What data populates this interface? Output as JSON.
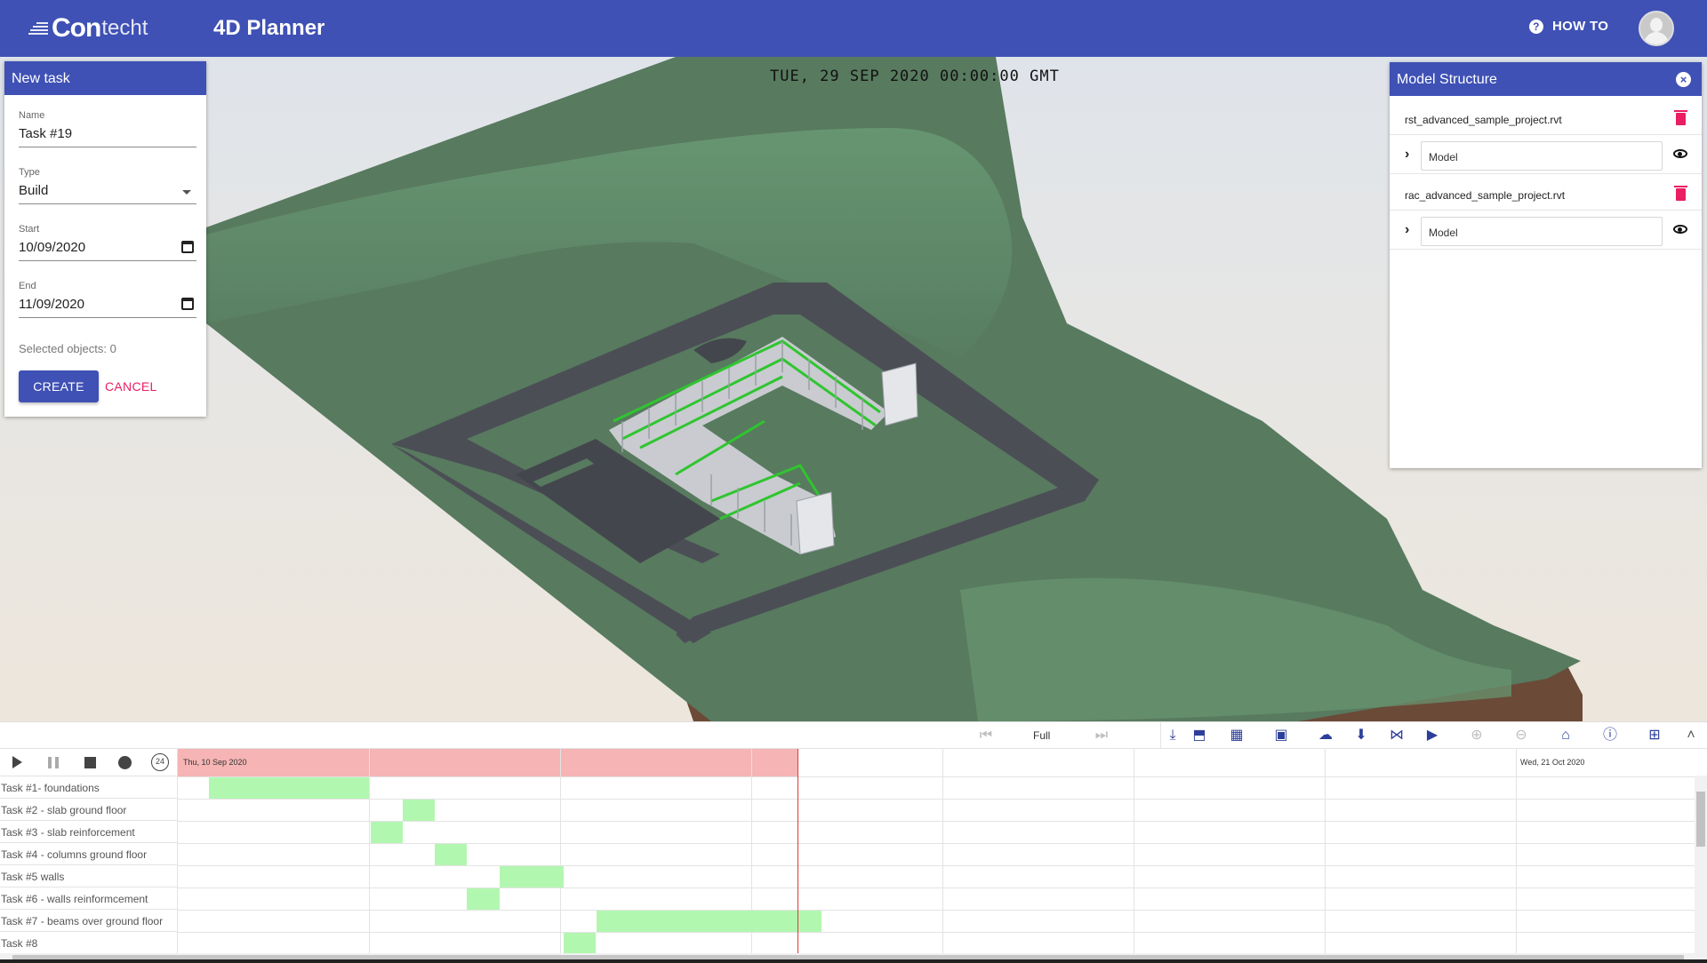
{
  "header": {
    "logo_c": "Con",
    "logo_t": "techt",
    "title": "4D Planner",
    "howto_label": "HOW TO",
    "colors": {
      "primary": "#3f51b5"
    }
  },
  "viewport": {
    "timestamp": "TUE, 29 SEP 2020 00:00:00 GMT"
  },
  "new_task": {
    "title": "New task",
    "name_label": "Name",
    "name_value": "Task #19",
    "type_label": "Type",
    "type_value": "Build",
    "start_label": "Start",
    "start_value": "10/09/2020",
    "end_label": "End",
    "end_value": "11/09/2020",
    "selected_objects": "Selected objects: 0",
    "create_label": "CREATE",
    "cancel_label": "CANCEL"
  },
  "model_structure": {
    "title": "Model Structure",
    "files": [
      {
        "name": "rst_advanced_sample_project.rvt",
        "model": "Model"
      },
      {
        "name": "rac_advanced_sample_project.rvt",
        "model": "Model"
      }
    ]
  },
  "toolbar": {
    "zoom_label": "Full"
  },
  "gantt": {
    "start_date": "Thu, 10 Sep 2020",
    "end_date": "Wed, 21 Oct 2020",
    "controls": {
      "speed_label": "24"
    },
    "tasks": [
      {
        "label": "Task #1- foundations"
      },
      {
        "label": "Task #2 - slab ground floor"
      },
      {
        "label": "Task #3 - slab reinforcement"
      },
      {
        "label": "Task #4 - columns ground floor"
      },
      {
        "label": "Task #5 walls"
      },
      {
        "label": "Task #6 - walls reinformcement"
      },
      {
        "label": "Task #7 - beams over ground floor"
      },
      {
        "label": "Task #8"
      }
    ]
  }
}
